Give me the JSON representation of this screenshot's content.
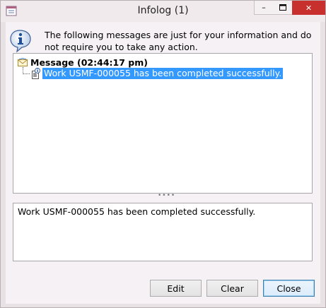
{
  "window": {
    "title": "Infolog (1)",
    "minimize_glyph": "–",
    "close_glyph": "✕"
  },
  "info": {
    "text": "The following messages are just for your information and do not require you to take any action."
  },
  "tree": {
    "root_label": "Message (02:44:17 pm)",
    "child_label": "Work USMF-000055 has been completed successfully."
  },
  "splitter": {
    "glyph": "••••"
  },
  "detail": {
    "text": "Work USMF-000055 has been completed successfully."
  },
  "buttons": {
    "edit": "Edit",
    "clear": "Clear",
    "close": "Close"
  },
  "colors": {
    "selection": "#3399ff",
    "close_button": "#c7302c"
  }
}
